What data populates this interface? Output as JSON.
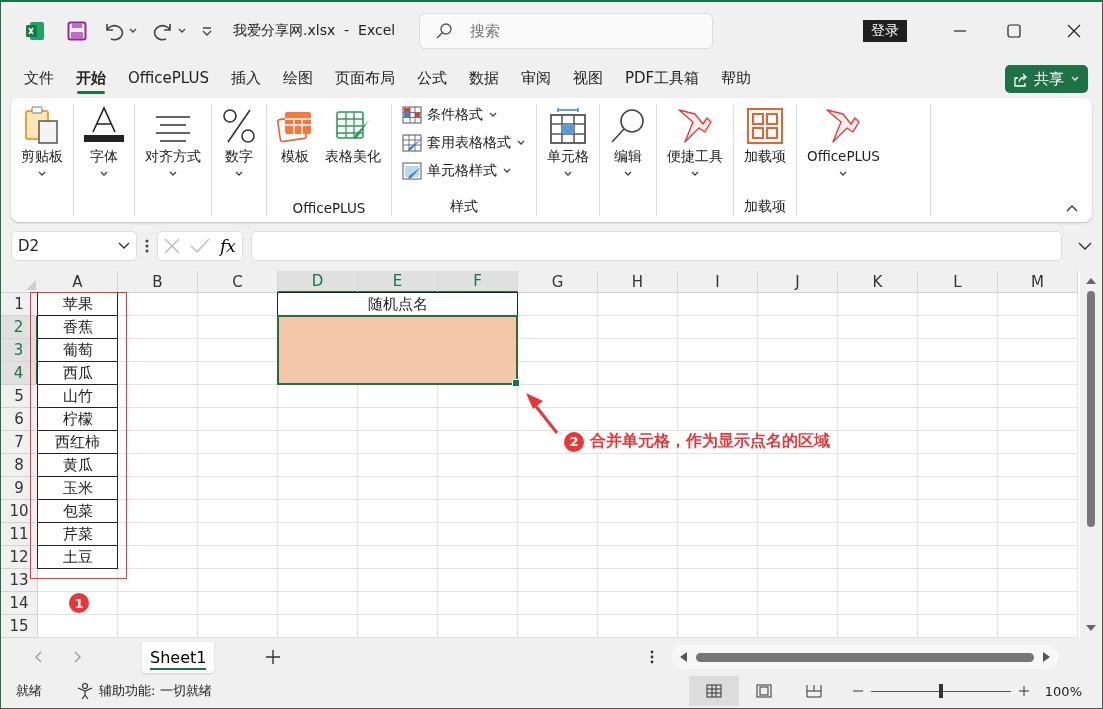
{
  "title_bar": {
    "title": "我爱分享网.xlsx  -  Excel",
    "search_placeholder": "搜索",
    "login": "登录"
  },
  "menu_tabs": [
    {
      "label": "文件",
      "selected": false
    },
    {
      "label": "开始",
      "selected": true
    },
    {
      "label": "OfficePLUS",
      "selected": false
    },
    {
      "label": "插入",
      "selected": false
    },
    {
      "label": "绘图",
      "selected": false
    },
    {
      "label": "页面布局",
      "selected": false
    },
    {
      "label": "公式",
      "selected": false
    },
    {
      "label": "数据",
      "selected": false
    },
    {
      "label": "审阅",
      "selected": false
    },
    {
      "label": "视图",
      "selected": false
    },
    {
      "label": "PDF工具箱",
      "selected": false
    },
    {
      "label": "帮助",
      "selected": false
    }
  ],
  "share_button": "共享",
  "ribbon_groups": [
    {
      "buttons": [
        {
          "label": "剪贴板",
          "kind": "large",
          "dropdown": true
        }
      ]
    },
    {
      "buttons": [
        {
          "label": "字体",
          "kind": "large",
          "dropdown": true
        }
      ]
    },
    {
      "buttons": [
        {
          "label": "对齐方式",
          "kind": "large",
          "dropdown": true
        }
      ]
    },
    {
      "buttons": [
        {
          "label": "数字",
          "kind": "large",
          "dropdown": true
        }
      ]
    },
    {
      "label": "OfficePLUS",
      "buttons": [
        {
          "label": "模板",
          "kind": "large",
          "dropdown": false
        },
        {
          "label": "表格美化",
          "kind": "large",
          "dropdown": false
        }
      ]
    },
    {
      "label": "样式",
      "buttons": [
        {
          "label": "条件格式",
          "kind": "small",
          "dropdown": true
        },
        {
          "label": "套用表格格式",
          "kind": "small",
          "dropdown": true
        },
        {
          "label": "单元格样式",
          "kind": "small",
          "dropdown": true
        }
      ]
    },
    {
      "buttons": [
        {
          "label": "单元格",
          "kind": "large",
          "dropdown": true
        }
      ]
    },
    {
      "buttons": [
        {
          "label": "编辑",
          "kind": "large",
          "dropdown": true
        }
      ]
    },
    {
      "buttons": [
        {
          "label": "便捷工具",
          "kind": "large",
          "dropdown": true
        }
      ]
    },
    {
      "label": "加载项",
      "buttons": [
        {
          "label": "加载项",
          "kind": "large",
          "dropdown": false
        }
      ]
    },
    {
      "buttons": [
        {
          "label": "OfficePLUS",
          "kind": "large",
          "dropdown": true
        }
      ]
    }
  ],
  "formula_bar": {
    "name_box": "D2",
    "fx": "fx"
  },
  "sheet": {
    "columns": [
      {
        "label": "A",
        "selected": false
      },
      {
        "label": "B",
        "selected": false
      },
      {
        "label": "C",
        "selected": false
      },
      {
        "label": "D",
        "selected": true
      },
      {
        "label": "E",
        "selected": true
      },
      {
        "label": "F",
        "selected": true
      },
      {
        "label": "G",
        "selected": false
      },
      {
        "label": "H",
        "selected": false
      },
      {
        "label": "I",
        "selected": false
      },
      {
        "label": "J",
        "selected": false
      },
      {
        "label": "K",
        "selected": false
      },
      {
        "label": "L",
        "selected": false
      },
      {
        "label": "M",
        "selected": false
      }
    ],
    "rows": [
      {
        "label": "1",
        "selected": false,
        "a": "苹果"
      },
      {
        "label": "2",
        "selected": true,
        "a": "香蕉"
      },
      {
        "label": "3",
        "selected": true,
        "a": "葡萄"
      },
      {
        "label": "4",
        "selected": true,
        "a": "西瓜"
      },
      {
        "label": "5",
        "selected": false,
        "a": "山竹"
      },
      {
        "label": "6",
        "selected": false,
        "a": "柠檬"
      },
      {
        "label": "7",
        "selected": false,
        "a": "西红柿"
      },
      {
        "label": "8",
        "selected": false,
        "a": "黄瓜"
      },
      {
        "label": "9",
        "selected": false,
        "a": "玉米"
      },
      {
        "label": "10",
        "selected": false,
        "a": "包菜"
      },
      {
        "label": "11",
        "selected": false,
        "a": "芹菜"
      },
      {
        "label": "12",
        "selected": false,
        "a": "土豆"
      },
      {
        "label": "13",
        "selected": false
      },
      {
        "label": "14",
        "selected": false
      },
      {
        "label": "15",
        "selected": false
      }
    ],
    "title_cell": {
      "text": "随机点名",
      "selected": false
    },
    "display_area": {
      "color": "#f4c6aa",
      "selected": true
    }
  },
  "annotations": [
    {
      "kind": "badge",
      "number": "1"
    },
    {
      "kind": "callout",
      "number": "2",
      "text": "合并单元格，作为显示点名的区域"
    }
  ],
  "sheet_tabs": [
    {
      "label": "Sheet1",
      "selected": true
    }
  ],
  "status_bar": {
    "status": "就绪",
    "accessibility": "辅助功能: 一切就绪",
    "views": [
      {
        "selected": true
      },
      {
        "selected": false
      },
      {
        "selected": false
      }
    ],
    "zoom": {
      "level": 0.5
    },
    "zoom_text": "100%"
  }
}
